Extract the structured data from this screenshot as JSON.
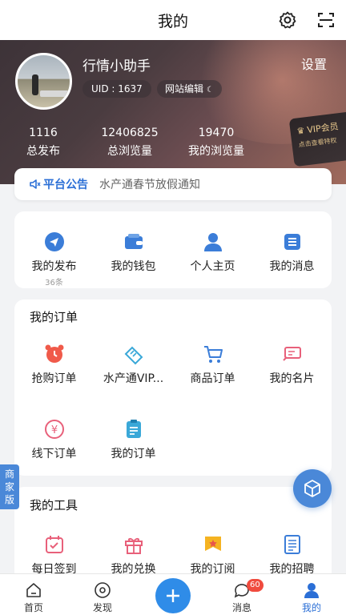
{
  "header": {
    "title": "我的"
  },
  "profile": {
    "username": "行情小助手",
    "uid": "UID : 1637",
    "website_edit": "网站编辑",
    "settings": "设置"
  },
  "stats": [
    {
      "value": "1116",
      "label": "总发布"
    },
    {
      "value": "12406825",
      "label": "总浏览量"
    },
    {
      "value": "19470",
      "label": "我的浏览量"
    }
  ],
  "vip_card": {
    "title": "VIP会员",
    "subtitle": "点击查看特权"
  },
  "notice": {
    "tag": "平台公告",
    "text": "水产通春节放假通知"
  },
  "quick": [
    {
      "label": "我的发布",
      "sub": "36条",
      "icon": "paper-plane-icon"
    },
    {
      "label": "我的钱包",
      "icon": "wallet-icon"
    },
    {
      "label": "个人主页",
      "icon": "person-icon"
    },
    {
      "label": "我的消息",
      "icon": "message-list-icon"
    }
  ],
  "orders": {
    "title": "我的订单",
    "items": [
      {
        "label": "抢购订单",
        "icon": "alarm-clock-icon"
      },
      {
        "label": "水产通VIP...",
        "icon": "vip-ticket-icon"
      },
      {
        "label": "商品订单",
        "icon": "shopping-cart-icon"
      },
      {
        "label": "我的名片",
        "icon": "business-card-icon"
      },
      {
        "label": "线下订单",
        "icon": "yen-coin-icon"
      },
      {
        "label": "我的订单",
        "icon": "clipboard-icon"
      }
    ]
  },
  "tools": {
    "title": "我的工具",
    "items": [
      {
        "label": "每日签到",
        "icon": "calendar-check-icon"
      },
      {
        "label": "我的兑换",
        "icon": "gift-icon"
      },
      {
        "label": "我的订阅",
        "icon": "subscribe-icon"
      },
      {
        "label": "我的招聘",
        "icon": "recruit-icon"
      }
    ]
  },
  "side_tab": {
    "label": "商家版"
  },
  "tabbar": {
    "items": [
      {
        "label": "首页",
        "icon": "home-icon"
      },
      {
        "label": "发现",
        "icon": "discover-icon"
      },
      {
        "label": "消息",
        "icon": "chat-icon",
        "badge": "60"
      },
      {
        "label": "我的",
        "icon": "profile-icon"
      }
    ]
  },
  "colors": {
    "accent": "#2b6fd6",
    "red": "#e84a3c",
    "badge": "#f04b3e"
  }
}
